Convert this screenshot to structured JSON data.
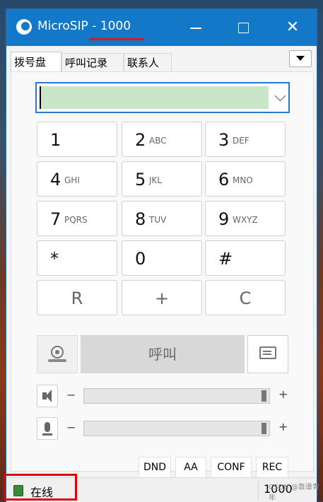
{
  "window": {
    "title": "MicroSIP - 1000",
    "controls": [
      "minimize",
      "maximize",
      "close"
    ]
  },
  "tabs": [
    {
      "label": "拨号盘",
      "active": true
    },
    {
      "label": "呼叫记录",
      "active": false
    },
    {
      "label": "联系人",
      "active": false
    }
  ],
  "dial": {
    "number_value": "",
    "keys": [
      {
        "digit": "1",
        "letters": ""
      },
      {
        "digit": "2",
        "letters": "ABC"
      },
      {
        "digit": "3",
        "letters": "DEF"
      },
      {
        "digit": "4",
        "letters": "GHI"
      },
      {
        "digit": "5",
        "letters": "JKL"
      },
      {
        "digit": "6",
        "letters": "MNO"
      },
      {
        "digit": "7",
        "letters": "PQRS"
      },
      {
        "digit": "8",
        "letters": "TUV"
      },
      {
        "digit": "9",
        "letters": "WXYZ"
      },
      {
        "digit": "*",
        "letters": ""
      },
      {
        "digit": "0",
        "letters": ""
      },
      {
        "digit": "#",
        "letters": ""
      },
      {
        "digit": "R",
        "letters": ""
      },
      {
        "digit": "+",
        "letters": ""
      },
      {
        "digit": "C",
        "letters": ""
      }
    ],
    "call_label": "呼叫"
  },
  "volume": {
    "minus": "−",
    "plus": "+",
    "speaker_level": 1.0,
    "mic_level": 1.0
  },
  "function_buttons": [
    "DND",
    "AA",
    "CONF",
    "REC"
  ],
  "status": {
    "text": "在线",
    "extension": "1000",
    "color": "#3a8a3a"
  },
  "watermark": "CSDN @靠谱青年"
}
